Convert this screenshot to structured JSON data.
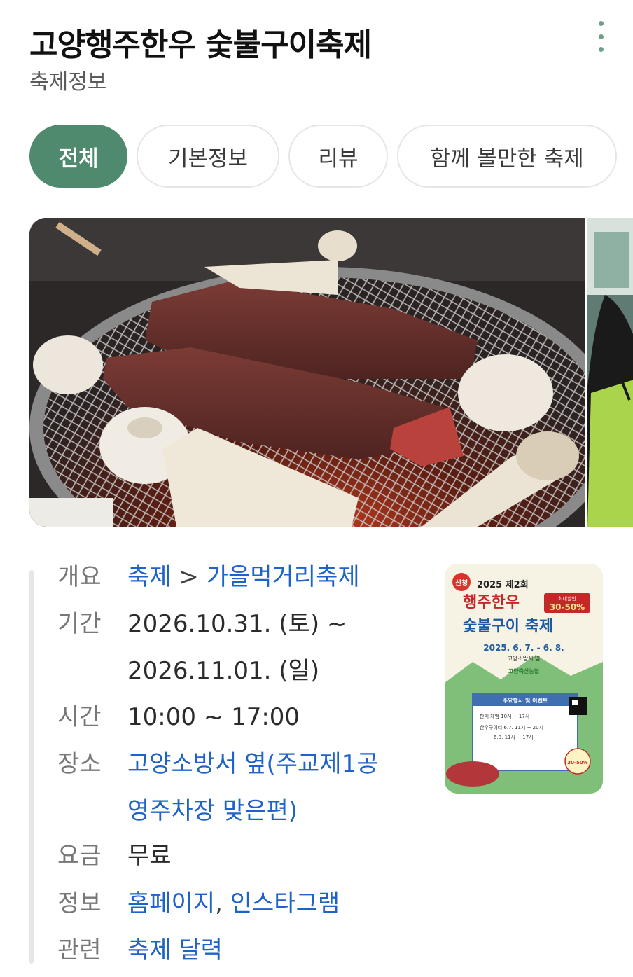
{
  "header": {
    "title": "고양행주한우 숯불구이축제",
    "subtitle": "축제정보"
  },
  "tabs": [
    {
      "label": "전체",
      "active": true
    },
    {
      "label": "기본정보",
      "active": false
    },
    {
      "label": "리뷰",
      "active": false
    },
    {
      "label": "함께 볼만한 축제",
      "active": false
    }
  ],
  "info": {
    "overview": {
      "label": "개요",
      "category": "축제",
      "separator": ">",
      "subcategory": "가을먹거리축제"
    },
    "period": {
      "label": "기간",
      "line1": "2026.10.31. (토) ~",
      "line2": "2026.11.01. (일)"
    },
    "time": {
      "label": "시간",
      "value": "10:00 ~ 17:00"
    },
    "place": {
      "label": "장소",
      "line1": "고양소방서 옆(주교제1공",
      "line2": "영주차장 맞은편)"
    },
    "fee": {
      "label": "요금",
      "value": "무료"
    },
    "links": {
      "label": "정보",
      "homepage": "홈페이지",
      "comma": ",",
      "instagram": "인스타그램"
    },
    "related": {
      "label": "관련",
      "value": "축제 달력"
    }
  },
  "poster": {
    "badge": "신청",
    "edition": "2025 제2회",
    "title1": "행주한우",
    "discount_note": "최대할인",
    "discount": "30-50%",
    "title2": "숯불구이 축제",
    "dates": "2025. 6. 7. - 6. 8.",
    "place": "고양소방서 옆",
    "org": "고양축산농협",
    "events_title": "주요행사 및 이벤트",
    "event1": "판매·체험 10시 ~ 17시",
    "event2": "한우구이터 6.7. 11시 ~ 20시",
    "event3": "6.8. 11시 ~ 17시",
    "promo": "30-50%"
  },
  "colors": {
    "accent": "#4f8a6e",
    "link": "#1f62c9",
    "label": "#777777"
  }
}
